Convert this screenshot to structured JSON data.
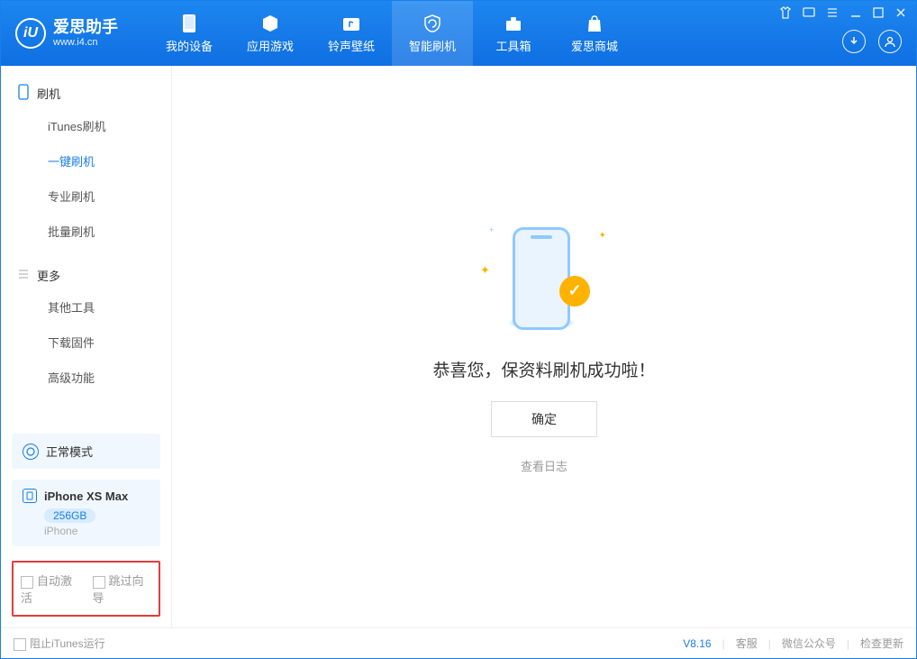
{
  "header": {
    "app_title": "爱思助手",
    "app_url": "www.i4.cn",
    "nav": [
      {
        "label": "我的设备"
      },
      {
        "label": "应用游戏"
      },
      {
        "label": "铃声壁纸"
      },
      {
        "label": "智能刷机"
      },
      {
        "label": "工具箱"
      },
      {
        "label": "爱思商城"
      }
    ]
  },
  "sidebar": {
    "section1": {
      "title": "刷机",
      "items": [
        {
          "label": "iTunes刷机"
        },
        {
          "label": "一键刷机"
        },
        {
          "label": "专业刷机"
        },
        {
          "label": "批量刷机"
        }
      ]
    },
    "section2": {
      "title": "更多",
      "items": [
        {
          "label": "其他工具"
        },
        {
          "label": "下载固件"
        },
        {
          "label": "高级功能"
        }
      ]
    },
    "mode": "正常模式",
    "device": {
      "name": "iPhone XS Max",
      "capacity": "256GB",
      "type": "iPhone"
    },
    "options": {
      "auto_activate": "自动激活",
      "skip_guide": "跳过向导"
    }
  },
  "main": {
    "success_msg": "恭喜您，保资料刷机成功啦！",
    "ok_btn": "确定",
    "view_log": "查看日志"
  },
  "status": {
    "block_itunes": "阻止iTunes运行",
    "version": "V8.16",
    "links": {
      "kefu": "客服",
      "wechat": "微信公众号",
      "update": "检查更新"
    }
  }
}
